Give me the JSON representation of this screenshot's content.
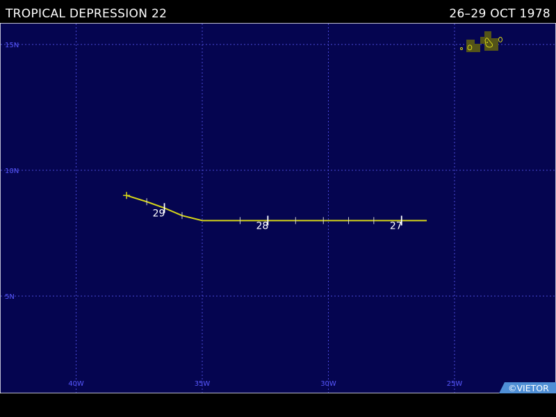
{
  "header": {
    "storm_name": "TROPICAL DEPRESSION 22",
    "date_range": "26–29 OCT 1978"
  },
  "map": {
    "lat_labels": [
      "15N",
      "10N",
      "5N"
    ],
    "lon_labels": [
      "40W",
      "35W",
      "30W",
      "25W"
    ],
    "lat_values": [
      15,
      10,
      5
    ],
    "lon_values": [
      -40,
      -35,
      -30,
      -25
    ],
    "colors": {
      "ocean": "#050550",
      "grid": "#4a4ad8",
      "label": "#5858ff",
      "track": "#d8d818",
      "land": "#545418",
      "coast": "#d8d818"
    }
  },
  "track": {
    "points": [
      {
        "lon": -26.1,
        "lat": 8.0
      },
      {
        "lon": -27.1,
        "lat": 8.0
      },
      {
        "lon": -28.2,
        "lat": 8.0
      },
      {
        "lon": -29.2,
        "lat": 8.0
      },
      {
        "lon": -30.2,
        "lat": 8.0
      },
      {
        "lon": -31.3,
        "lat": 8.0
      },
      {
        "lon": -32.4,
        "lat": 8.0
      },
      {
        "lon": -33.5,
        "lat": 8.0
      },
      {
        "lon": -35.0,
        "lat": 8.0
      },
      {
        "lon": -35.8,
        "lat": 8.2
      },
      {
        "lon": -36.5,
        "lat": 8.5
      },
      {
        "lon": -37.2,
        "lat": 8.75
      },
      {
        "lon": -38.0,
        "lat": 9.0
      }
    ],
    "day_marks": [
      {
        "label": "27",
        "lon": -27.1,
        "lat": 8.0
      },
      {
        "label": "28",
        "lon": -32.4,
        "lat": 8.0
      },
      {
        "label": "29",
        "lon": -36.5,
        "lat": 8.5
      }
    ]
  },
  "copyright": "©VIETOR"
}
